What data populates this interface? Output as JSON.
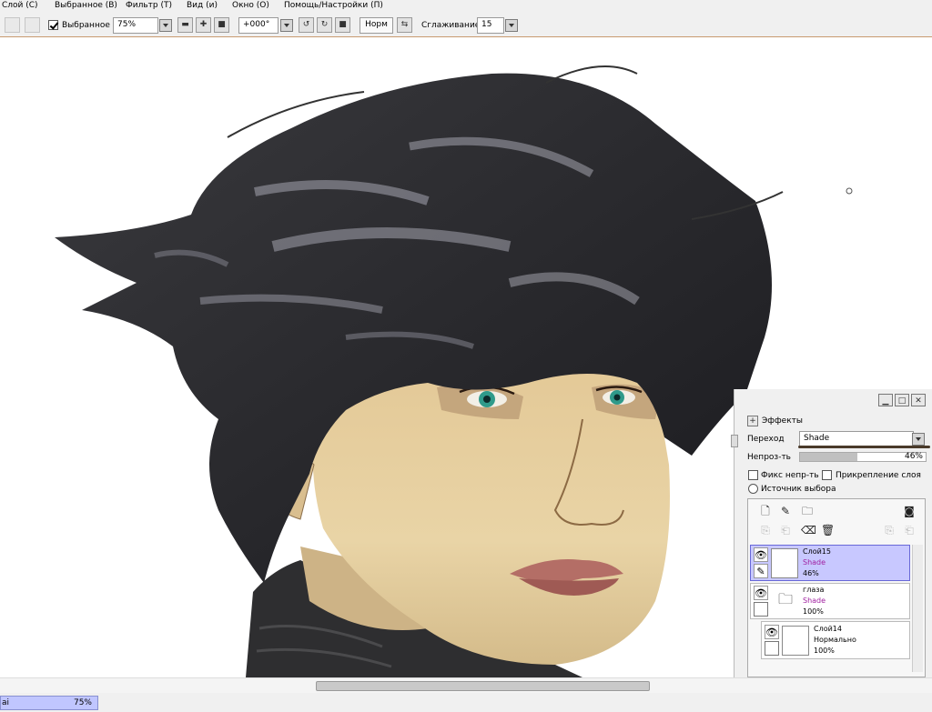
{
  "menu": {
    "items": [
      "Слой (С)",
      "Выбранное (В)",
      "Фильтр (Т)",
      "Вид (и)",
      "Окно (О)",
      "Помощь/Настройки (П)"
    ]
  },
  "toolbar": {
    "selection_check_label": "Выбранное",
    "zoom_value": "75%",
    "rotation_value": "+000°",
    "normal_button": "Норм",
    "smoothing_label": "Сглаживание",
    "smoothing_value": "15"
  },
  "status": {
    "left_text": "ai",
    "zoom_text": "75%"
  },
  "layer_panel": {
    "effects_label": "Эффекты",
    "blend_label": "Переход",
    "blend_value": "Shade",
    "opacity_label": "Непроз-ть",
    "opacity_value": "46%",
    "opacity_fraction": 0.46,
    "preserve_opacity_label": "Фикс непр-ть",
    "clipping_label": "Прикрепление слоя",
    "selection_source_label": "Источник выбора",
    "layers": [
      {
        "name": "Слой15",
        "mode": "Shade",
        "opacity": "46%",
        "selected": true
      },
      {
        "name": "глаза",
        "mode": "Shade",
        "opacity": "100%",
        "selected": false
      },
      {
        "name": "Слой14",
        "mode": "Нормально",
        "opacity": "100%",
        "selected": false
      }
    ]
  },
  "colors": {
    "selected_layer": "#c8c8ff",
    "blend_mode_text": "#a020a0",
    "status_fill": "#c0c6ff"
  }
}
